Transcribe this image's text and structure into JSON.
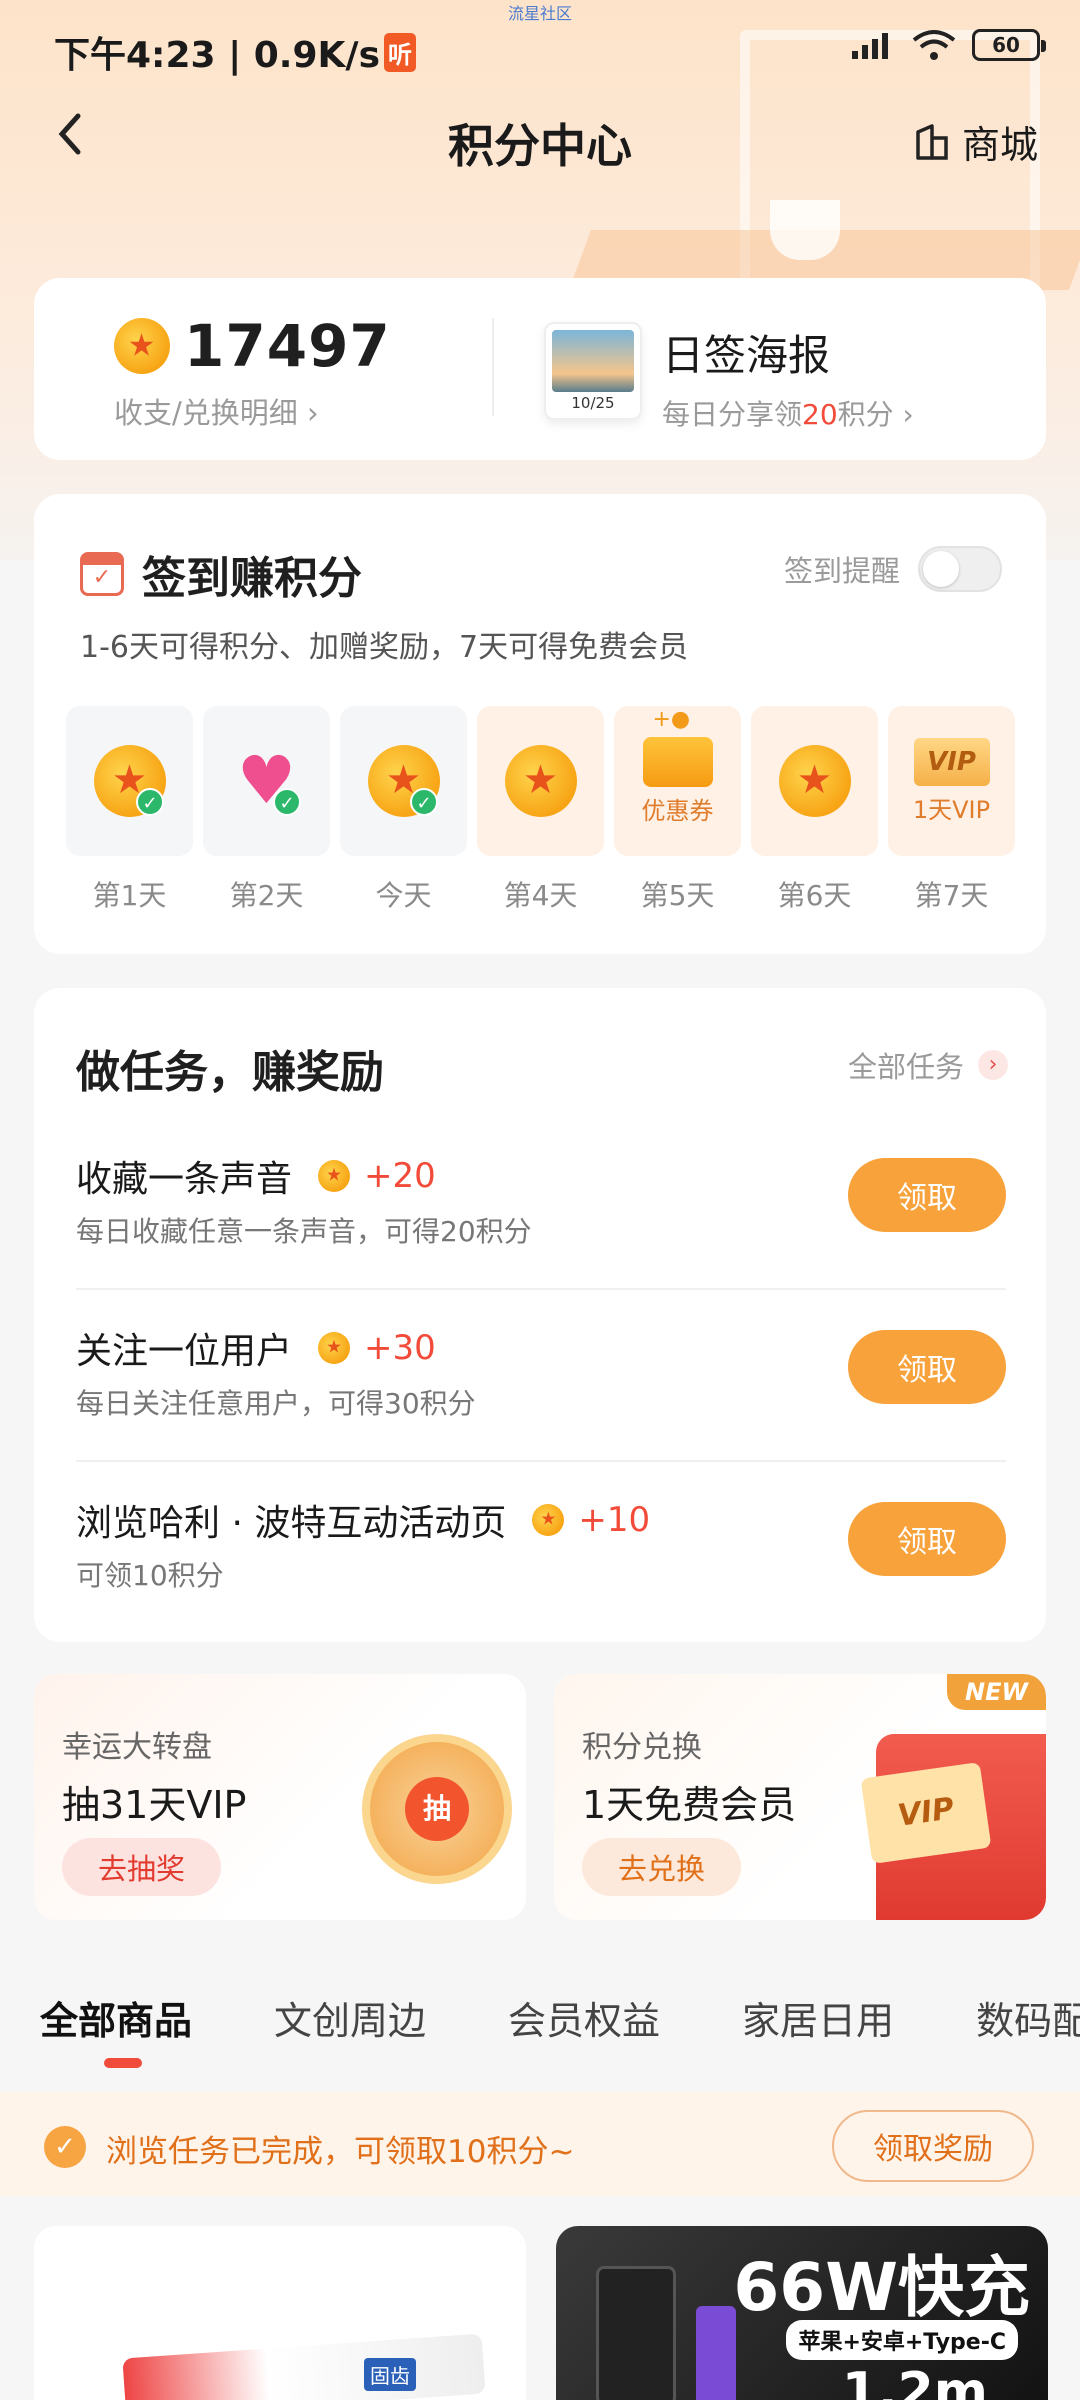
{
  "status_bar": {
    "time": "下午4:23 | 0.9K/s",
    "app_badge": "听",
    "center_text": "流星社区",
    "battery": "60"
  },
  "nav": {
    "back_icon": "chevron-left-icon",
    "title": "积分中心",
    "mall_label": "商城"
  },
  "points": {
    "value": "17497",
    "detail_link": "收支/兑换明细 ›",
    "poster_date": "10/25",
    "poster_title": "日签海报",
    "poster_sub_prefix": "每日分享领",
    "poster_sub_num": "20",
    "poster_sub_suffix": "积分 ›"
  },
  "checkin": {
    "title": "签到赚积分",
    "remind_label": "签到提醒",
    "remind_on": false,
    "desc": "1-6天可得积分、加赠奖励，7天可得免费会员",
    "days": [
      {
        "label": "第1天",
        "icon": "coin-icon",
        "checked": true
      },
      {
        "label": "第2天",
        "icon": "heart-icon",
        "checked": true
      },
      {
        "label": "今天",
        "icon": "coin-icon",
        "checked": true
      },
      {
        "label": "第4天",
        "icon": "coin-icon",
        "checked": false
      },
      {
        "label": "第5天",
        "icon": "coupon-icon",
        "sub": "优惠券",
        "checked": false
      },
      {
        "label": "第6天",
        "icon": "coin-icon",
        "checked": false
      },
      {
        "label": "第7天",
        "icon": "vip-icon",
        "sub": "1天VIP",
        "badge": "VIP",
        "checked": false
      }
    ]
  },
  "tasks": {
    "title": "做任务，赚奖励",
    "all_label": "全部任务",
    "claim_label": "领取",
    "items": [
      {
        "name": "收藏一条声音",
        "reward": "+20",
        "desc": "每日收藏任意一条声音，可得20积分"
      },
      {
        "name": "关注一位用户",
        "reward": "+30",
        "desc": "每日关注任意用户，可得30积分"
      },
      {
        "name": "浏览哈利 · 波特互动活动页",
        "reward": "+10",
        "desc": "可领10积分"
      }
    ]
  },
  "promos": {
    "wheel": {
      "label": "幸运大转盘",
      "title": "抽31天VIP",
      "button": "去抽奖",
      "center": "抽"
    },
    "exchange": {
      "label": "积分兑换",
      "title": "1天免费会员",
      "button": "去兑换",
      "badge": "NEW",
      "card_text": "VIP"
    }
  },
  "tabs": [
    "全部商品",
    "文创周边",
    "会员权益",
    "家居日用",
    "数码配"
  ],
  "notice": {
    "text": "浏览任务已完成，可领取10积分~",
    "button": "领取奖励"
  },
  "products": {
    "p1_label": "固齿",
    "p2_title": "66W快充",
    "p2_tag": "苹果+安卓+Type-C",
    "p2_length": "1.2m"
  },
  "colors": {
    "accent_orange": "#f8a23c",
    "reward_red": "#f24b3a",
    "hero_bg": "#fde3c9"
  }
}
